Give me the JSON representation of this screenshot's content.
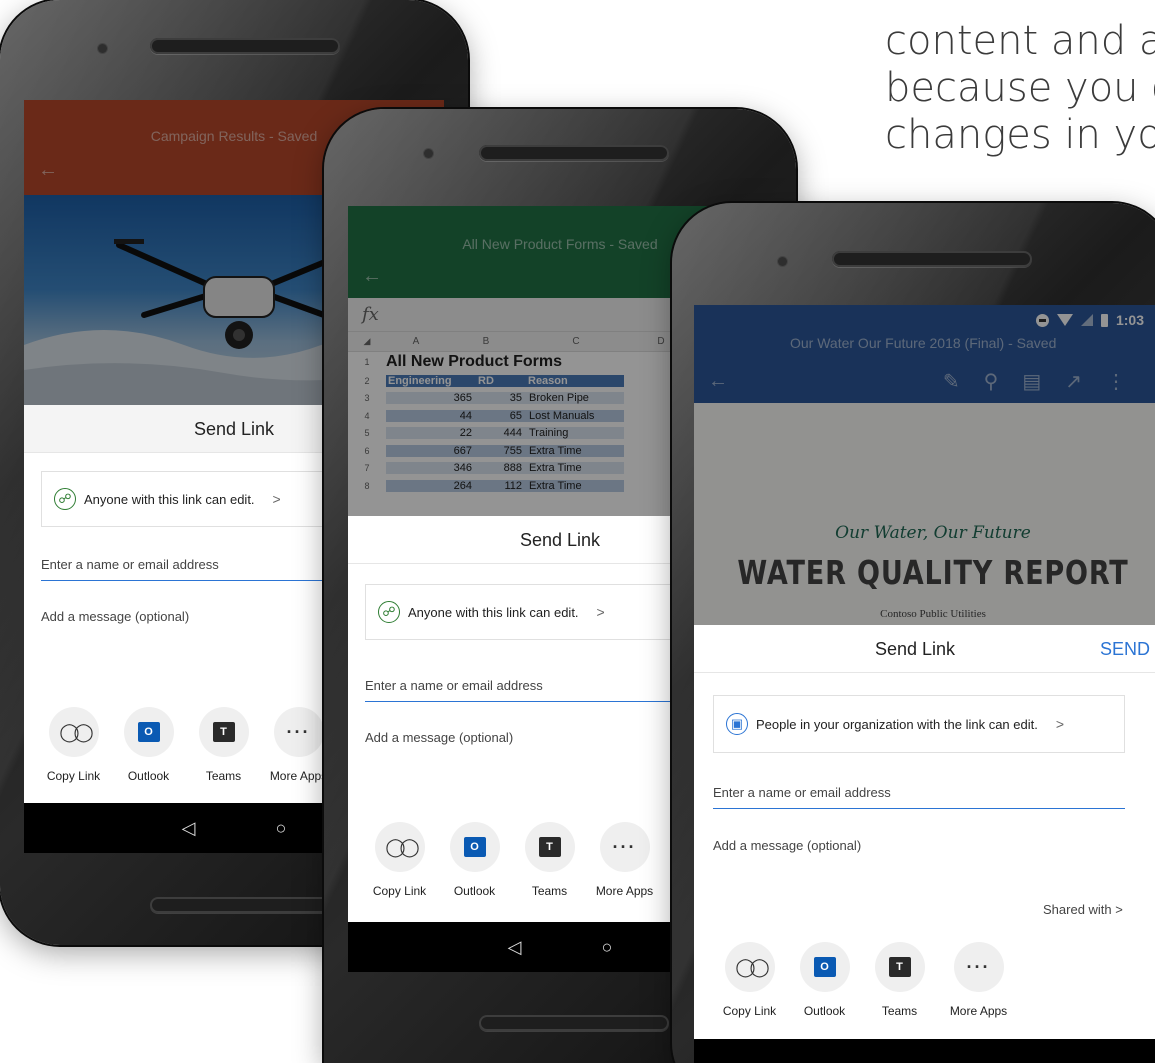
{
  "headline": {
    "lines": [
      "content and a",
      "because you c",
      "changes in yo"
    ]
  },
  "phones": {
    "ppt": {
      "title": "Campaign Results - Saved",
      "sheet_title": "Send Link",
      "permission": "Anyone with this link can edit.",
      "recipient_placeholder": "Enter a name or email address",
      "message_placeholder": "Add a message (optional)",
      "apps": [
        "Copy Link",
        "Outlook",
        "Teams",
        "More Apps"
      ],
      "accent": "#b7472a"
    },
    "excel": {
      "title": "All New Product Forms - Saved",
      "sheet_title": "Send Link",
      "permission": "Anyone with this link can edit.",
      "recipient_placeholder": "Enter a name or email address",
      "message_placeholder": "Add a message (optional)",
      "apps": [
        "Copy Link",
        "Outlook",
        "Teams",
        "More Apps"
      ],
      "accent": "#217346",
      "fx": "fx",
      "columns": [
        "A",
        "B",
        "C",
        "D"
      ],
      "sheet_heading": "All New Product Forms",
      "headers": [
        "Engineering",
        "RD",
        "Reason"
      ],
      "rows": [
        {
          "n": "3",
          "a": "365",
          "b": "35",
          "c": "Broken Pipe"
        },
        {
          "n": "4",
          "a": "44",
          "b": "65",
          "c": "Lost Manuals"
        },
        {
          "n": "5",
          "a": "22",
          "b": "444",
          "c": "Training"
        },
        {
          "n": "6",
          "a": "667",
          "b": "755",
          "c": "Extra Time"
        },
        {
          "n": "7",
          "a": "346",
          "b": "888",
          "c": "Extra Time"
        },
        {
          "n": "8",
          "a": "264",
          "b": "112",
          "c": "Extra Time"
        }
      ],
      "row_numbers": [
        "1",
        "2"
      ]
    },
    "word": {
      "status_time": "1:03",
      "title": "Our Water Our Future 2018 (Final) - Saved",
      "doc_script": "Our Water, Our Future",
      "doc_title": "WATER QUALITY REPORT",
      "doc_sub": "Contoso Public Utilities",
      "sheet_title": "Send Link",
      "send": "SEND",
      "permission": "People in your organization with the link can edit.",
      "recipient_placeholder": "Enter a name or email address",
      "message_placeholder": "Add a message (optional)",
      "shared_with": "Shared with",
      "apps": [
        "Copy Link",
        "Outlook",
        "Teams",
        "More Apps"
      ],
      "accent": "#2b579a"
    }
  }
}
